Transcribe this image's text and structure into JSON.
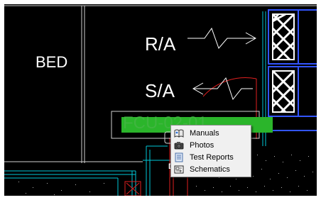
{
  "drawing": {
    "room_label": "BED",
    "return_air_label": "R/A",
    "supply_air_label": "S/A",
    "equipment_tag": "FCU-02-01",
    "partial_text": "D"
  },
  "context_menu": {
    "items": [
      {
        "label": "Manuals",
        "icon": "manual-book-icon"
      },
      {
        "label": "Photos",
        "icon": "camera-icon"
      },
      {
        "label": "Test Reports",
        "icon": "report-icon"
      },
      {
        "label": "Schematics",
        "icon": "schematic-icon"
      }
    ]
  },
  "colors": {
    "background": "#000000",
    "lines": "#ffffff",
    "cyan_lines": "#00c8d8",
    "blue_frames": "#3355ff",
    "red_lines": "#e02020",
    "tag_highlight": "#2bb52b"
  }
}
